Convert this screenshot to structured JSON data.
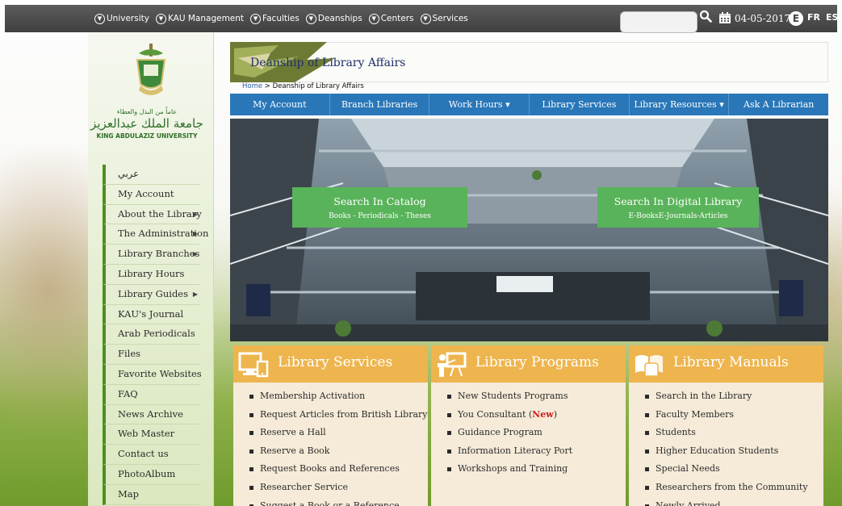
{
  "topbar": {
    "nav": [
      "University",
      "KAU Management",
      "Faculties",
      "Deanships",
      "Centers",
      "Services"
    ],
    "search_value": "",
    "date": "04-05-2017",
    "lang_e": "E",
    "lang_fr": "FR",
    "lang_es": "ES"
  },
  "sidebar": {
    "logo_ar_small": "عاماً من البذل والعطاء",
    "logo_ar": "جامعة الملك عبدالعزيز",
    "logo_en": "KING ABDULAZIZ UNIVERSITY",
    "items": [
      {
        "label": "عربي",
        "arrow": ""
      },
      {
        "label": "My Account",
        "arrow": ""
      },
      {
        "label": "About the Library",
        "arrow": "▶"
      },
      {
        "label": "The Administration",
        "arrow": "▶"
      },
      {
        "label": "Library Branches",
        "arrow": "▶"
      },
      {
        "label": "Library Hours",
        "arrow": ""
      },
      {
        "label": "Library Guides",
        "arrow": "▶"
      },
      {
        "label": "KAU's Journal",
        "arrow": ""
      },
      {
        "label": "Arab Periodicals",
        "arrow": ""
      },
      {
        "label": "Files",
        "arrow": ""
      },
      {
        "label": "Favorite Websites",
        "arrow": ""
      },
      {
        "label": "FAQ",
        "arrow": ""
      },
      {
        "label": "News Archive",
        "arrow": ""
      },
      {
        "label": "Web Master",
        "arrow": ""
      },
      {
        "label": "Contact us",
        "arrow": ""
      },
      {
        "label": "PhotoAlbum",
        "arrow": ""
      },
      {
        "label": "Map",
        "arrow": ""
      }
    ]
  },
  "header": {
    "title": "Deanship of Library Affairs",
    "breadcrumb_home": "Home",
    "breadcrumb_sep": " > ",
    "breadcrumb_current": "Deanship of Library Affairs"
  },
  "navbar": [
    "My Account",
    "Branch Libraries",
    "Work Hours ▾",
    "Library Services",
    "Library Resources ▾",
    "Ask A Librarian"
  ],
  "hero": {
    "catalog_title": "Search In Catalog",
    "catalog_sub": "Books - Periodicals - Theses",
    "digital_title": "Search In Digital Library",
    "digital_sub": "E-BooksE-Journals-Articles"
  },
  "columns": {
    "services": {
      "title": "Library Services",
      "items": [
        "Membership Activation",
        "Request Articles from British Library",
        "Reserve a Hall",
        "Reserve a Book",
        "Request Books and References",
        "Researcher Service",
        "Suggest a Book or a Reference"
      ]
    },
    "programs": {
      "title": "Library Programs",
      "items": [
        "New Students Programs",
        "You Consultant (",
        "Guidance Program",
        "Information Literacy Port",
        "Workshops and Training"
      ],
      "new_label": "New",
      "close_paren": ")"
    },
    "manuals": {
      "title": "Library Manuals",
      "items": [
        "Search in the Library",
        "Faculty Members",
        "Students",
        "Higher Education Students",
        "Special Needs",
        "Researchers from the Community",
        "Newly Arrived"
      ]
    }
  },
  "colors": {
    "topbar": "#4a4a4a",
    "navbar": "#2977b8",
    "cta_green": "#59b35a",
    "column_header": "#eeb54e",
    "column_body": "#f5ebd8",
    "sidebar_accent": "#4e8f1e"
  }
}
